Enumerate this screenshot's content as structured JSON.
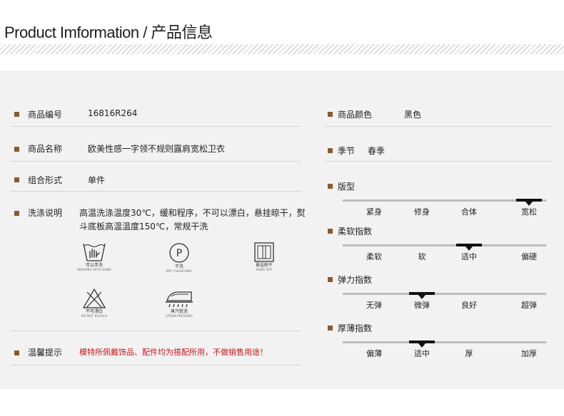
{
  "header": {
    "title": "Product Imformation / 产品信息"
  },
  "colors": {
    "bullet": "#8a5a2b",
    "accent": "#c8141b",
    "panel": "#f2f2f2"
  },
  "left": {
    "code": {
      "label": "商品编号",
      "value": "16816R264"
    },
    "name": {
      "label": "商品名称",
      "value": "欧美性感一字领不规则露肩宽松卫衣"
    },
    "combo": {
      "label": "组合形式",
      "value": "单件"
    },
    "wash": {
      "label": "洗涤说明",
      "value": "高温洗涤温度30℃，缓和程序，不可以漂白，悬挂晾干，熨斗底板高温温度150℃，常规干洗"
    },
    "care": [
      {
        "icon": "hand-wash-icon",
        "cap": "可以手洗",
        "sub": "WASHING WITH HAND"
      },
      {
        "icon": "dry-clean-icon",
        "cap": "干洗",
        "sub": "DRY CLEAN ONLY"
      },
      {
        "icon": "hang-dry-icon",
        "cap": "悬挂晾干",
        "sub": "HANG DRY"
      },
      {
        "icon": "no-bleach-icon",
        "cap": "不可漂白",
        "sub": "DO NOT BLEACH"
      },
      {
        "icon": "steam-iron-icon",
        "cap": "蒸汽熨烫",
        "sub": "STEAM PRESSING"
      }
    ],
    "dry_clean_letter": "P",
    "tip": {
      "label": "温馨提示",
      "value": "模特所佩戴饰品、配件均为搭配所用，不做销售用途！"
    }
  },
  "right": {
    "color": {
      "label": "商品颜色",
      "value": "黑色"
    },
    "season": {
      "label": "季节",
      "value": "春季"
    },
    "scales": [
      {
        "label": "版型",
        "options": [
          "紧身",
          "修身",
          "合体",
          "宽松"
        ],
        "selected": 3
      },
      {
        "label": "柔软指数",
        "options": [
          "柔软",
          "软",
          "适中",
          "偏硬"
        ],
        "selected": 2
      },
      {
        "label": "弹力指数",
        "options": [
          "无弹",
          "微弹",
          "良好",
          "超弹"
        ],
        "selected": 1
      },
      {
        "label": "厚薄指数",
        "options": [
          "偏薄",
          "适中",
          "厚",
          "加厚"
        ],
        "selected": 1
      }
    ]
  }
}
